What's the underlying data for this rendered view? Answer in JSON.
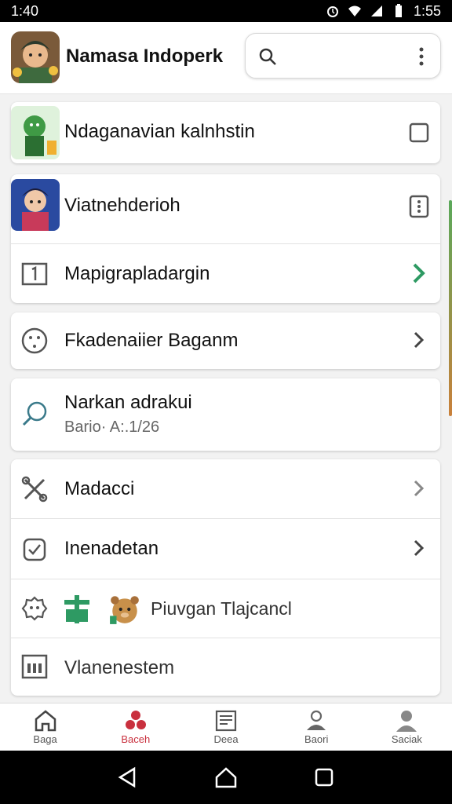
{
  "status_bar": {
    "time_left": "1:40",
    "time_right": "1:55"
  },
  "header": {
    "title": "Namasa Indoperk"
  },
  "rows": {
    "r1": {
      "label": "Ndaganavian kalnhstin"
    },
    "r2": {
      "label": "Viatnehderioh"
    },
    "r3": {
      "label": "Mapigrapladargin"
    },
    "r4": {
      "label": "Fkadenaiier Baganm"
    },
    "r5": {
      "label": "Narkan adrakui",
      "sub": "Bario· A:.1/26"
    },
    "r6": {
      "label": "Madacci"
    },
    "r7": {
      "label": "Inenadetan"
    },
    "r8": {
      "label": "Piuvgan Tlajcancl"
    },
    "r9": {
      "label": "Vlanenestem"
    }
  },
  "bottom_nav": [
    {
      "label": "Baga",
      "icon": "home-icon"
    },
    {
      "label": "Baceh",
      "icon": "people-icon"
    },
    {
      "label": "Deea",
      "icon": "news-icon"
    },
    {
      "label": "Baori",
      "icon": "person-badge-icon"
    },
    {
      "label": "Saciak",
      "icon": "person-icon"
    }
  ],
  "colors": {
    "accent_green": "#2e9a63",
    "accent_red": "#c9303e",
    "icon_gray": "#555555"
  }
}
